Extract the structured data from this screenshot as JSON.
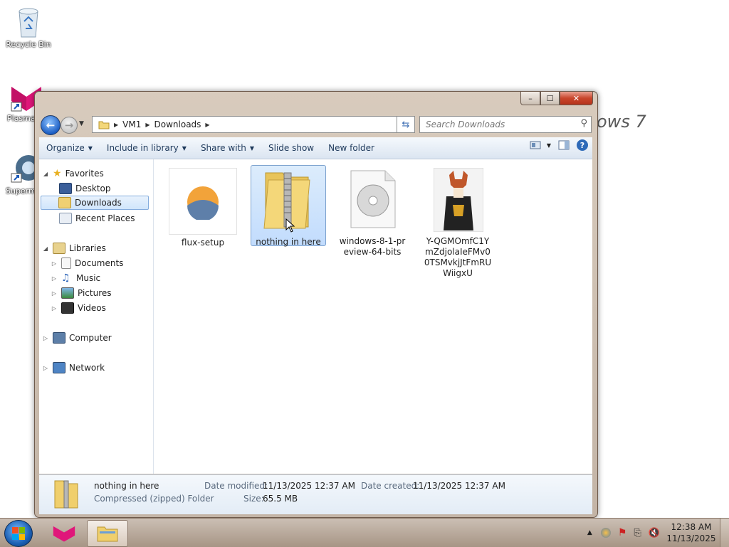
{
  "desktop": {
    "recycle_bin": "Recycle Bin",
    "plasma": "Plasma",
    "supermium": "Superm",
    "wallpaper_text": "ows 7"
  },
  "window": {
    "caption": {
      "minimize": "–",
      "maximize": "☐",
      "close": "✕"
    },
    "address": {
      "segments": [
        "VM1",
        "Downloads"
      ]
    },
    "search": {
      "placeholder": "Search Downloads"
    },
    "toolbar": {
      "organize": "Organize",
      "include_in_library": "Include in library",
      "share_with": "Share with",
      "slide_show": "Slide show",
      "new_folder": "New folder"
    },
    "nav": {
      "favorites": "Favorites",
      "desktop": "Desktop",
      "downloads": "Downloads",
      "recent_places": "Recent Places",
      "libraries": "Libraries",
      "documents": "Documents",
      "music": "Music",
      "pictures": "Pictures",
      "videos": "Videos",
      "computer": "Computer",
      "network": "Network"
    },
    "files": [
      {
        "name": "flux-setup"
      },
      {
        "name": "nothing in here"
      },
      {
        "name": "windows-8-1-preview-64-bits"
      },
      {
        "name": "Y-QGMOmfC1YmZdjolaIeFMv00TSMvkjJtFmRUWiigxU"
      }
    ],
    "details": {
      "name": "nothing in here",
      "type": "Compressed (zipped) Folder",
      "date_modified_label": "Date modified:",
      "date_modified": "11/13/2025 12:37 AM",
      "date_created_label": "Date created:",
      "date_created": "11/13/2025 12:37 AM",
      "size_label": "Size:",
      "size": "65.5 MB"
    }
  },
  "taskbar": {
    "time": "12:38 AM",
    "date": "11/13/2025"
  },
  "colors": {
    "accent": "#1d5fc4",
    "selection": "#c2dcfd",
    "taskbar": "#b8a898"
  }
}
